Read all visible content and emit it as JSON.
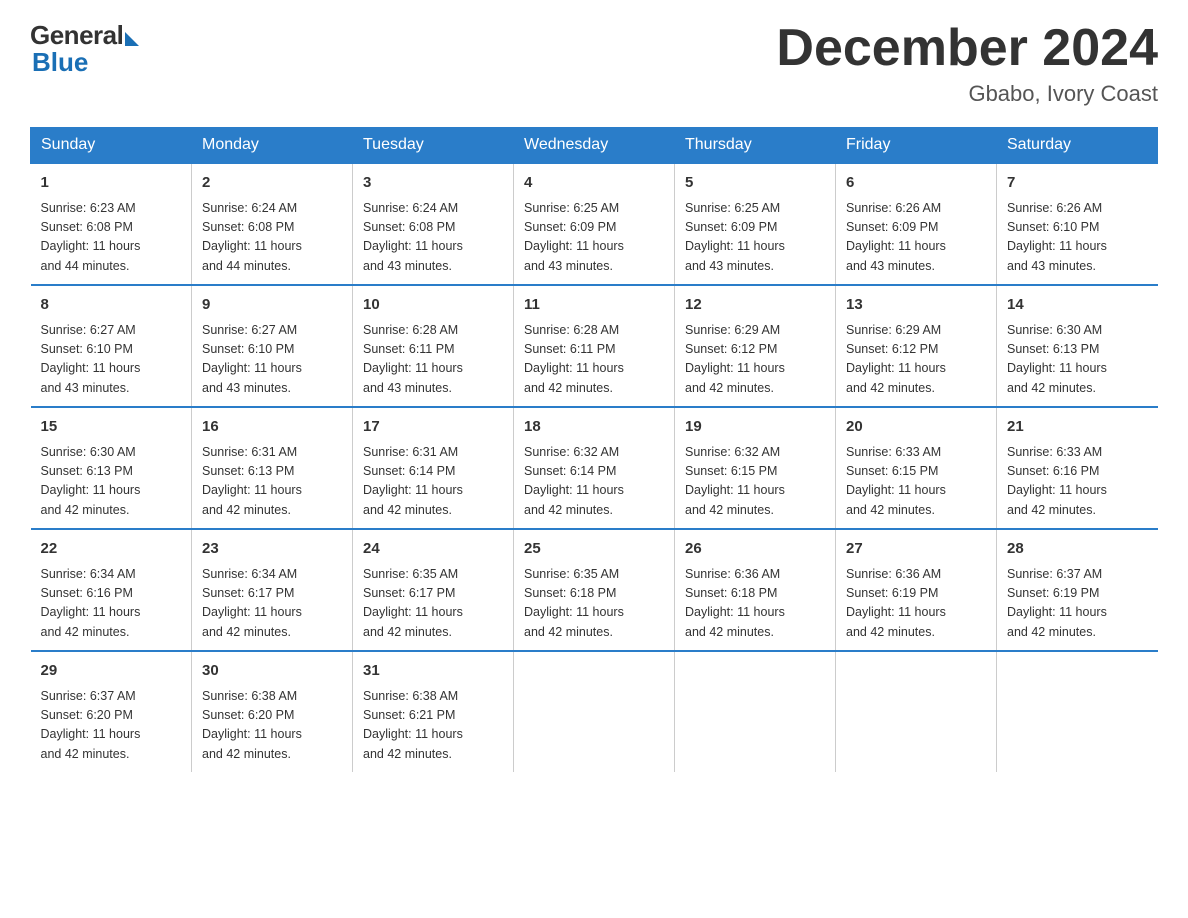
{
  "logo": {
    "general": "General",
    "blue": "Blue"
  },
  "title": "December 2024",
  "location": "Gbabo, Ivory Coast",
  "weekdays": [
    "Sunday",
    "Monday",
    "Tuesday",
    "Wednesday",
    "Thursday",
    "Friday",
    "Saturday"
  ],
  "weeks": [
    [
      {
        "day": "1",
        "sunrise": "6:23 AM",
        "sunset": "6:08 PM",
        "daylight": "11 hours and 44 minutes."
      },
      {
        "day": "2",
        "sunrise": "6:24 AM",
        "sunset": "6:08 PM",
        "daylight": "11 hours and 44 minutes."
      },
      {
        "day": "3",
        "sunrise": "6:24 AM",
        "sunset": "6:08 PM",
        "daylight": "11 hours and 43 minutes."
      },
      {
        "day": "4",
        "sunrise": "6:25 AM",
        "sunset": "6:09 PM",
        "daylight": "11 hours and 43 minutes."
      },
      {
        "day": "5",
        "sunrise": "6:25 AM",
        "sunset": "6:09 PM",
        "daylight": "11 hours and 43 minutes."
      },
      {
        "day": "6",
        "sunrise": "6:26 AM",
        "sunset": "6:09 PM",
        "daylight": "11 hours and 43 minutes."
      },
      {
        "day": "7",
        "sunrise": "6:26 AM",
        "sunset": "6:10 PM",
        "daylight": "11 hours and 43 minutes."
      }
    ],
    [
      {
        "day": "8",
        "sunrise": "6:27 AM",
        "sunset": "6:10 PM",
        "daylight": "11 hours and 43 minutes."
      },
      {
        "day": "9",
        "sunrise": "6:27 AM",
        "sunset": "6:10 PM",
        "daylight": "11 hours and 43 minutes."
      },
      {
        "day": "10",
        "sunrise": "6:28 AM",
        "sunset": "6:11 PM",
        "daylight": "11 hours and 43 minutes."
      },
      {
        "day": "11",
        "sunrise": "6:28 AM",
        "sunset": "6:11 PM",
        "daylight": "11 hours and 42 minutes."
      },
      {
        "day": "12",
        "sunrise": "6:29 AM",
        "sunset": "6:12 PM",
        "daylight": "11 hours and 42 minutes."
      },
      {
        "day": "13",
        "sunrise": "6:29 AM",
        "sunset": "6:12 PM",
        "daylight": "11 hours and 42 minutes."
      },
      {
        "day": "14",
        "sunrise": "6:30 AM",
        "sunset": "6:13 PM",
        "daylight": "11 hours and 42 minutes."
      }
    ],
    [
      {
        "day": "15",
        "sunrise": "6:30 AM",
        "sunset": "6:13 PM",
        "daylight": "11 hours and 42 minutes."
      },
      {
        "day": "16",
        "sunrise": "6:31 AM",
        "sunset": "6:13 PM",
        "daylight": "11 hours and 42 minutes."
      },
      {
        "day": "17",
        "sunrise": "6:31 AM",
        "sunset": "6:14 PM",
        "daylight": "11 hours and 42 minutes."
      },
      {
        "day": "18",
        "sunrise": "6:32 AM",
        "sunset": "6:14 PM",
        "daylight": "11 hours and 42 minutes."
      },
      {
        "day": "19",
        "sunrise": "6:32 AM",
        "sunset": "6:15 PM",
        "daylight": "11 hours and 42 minutes."
      },
      {
        "day": "20",
        "sunrise": "6:33 AM",
        "sunset": "6:15 PM",
        "daylight": "11 hours and 42 minutes."
      },
      {
        "day": "21",
        "sunrise": "6:33 AM",
        "sunset": "6:16 PM",
        "daylight": "11 hours and 42 minutes."
      }
    ],
    [
      {
        "day": "22",
        "sunrise": "6:34 AM",
        "sunset": "6:16 PM",
        "daylight": "11 hours and 42 minutes."
      },
      {
        "day": "23",
        "sunrise": "6:34 AM",
        "sunset": "6:17 PM",
        "daylight": "11 hours and 42 minutes."
      },
      {
        "day": "24",
        "sunrise": "6:35 AM",
        "sunset": "6:17 PM",
        "daylight": "11 hours and 42 minutes."
      },
      {
        "day": "25",
        "sunrise": "6:35 AM",
        "sunset": "6:18 PM",
        "daylight": "11 hours and 42 minutes."
      },
      {
        "day": "26",
        "sunrise": "6:36 AM",
        "sunset": "6:18 PM",
        "daylight": "11 hours and 42 minutes."
      },
      {
        "day": "27",
        "sunrise": "6:36 AM",
        "sunset": "6:19 PM",
        "daylight": "11 hours and 42 minutes."
      },
      {
        "day": "28",
        "sunrise": "6:37 AM",
        "sunset": "6:19 PM",
        "daylight": "11 hours and 42 minutes."
      }
    ],
    [
      {
        "day": "29",
        "sunrise": "6:37 AM",
        "sunset": "6:20 PM",
        "daylight": "11 hours and 42 minutes."
      },
      {
        "day": "30",
        "sunrise": "6:38 AM",
        "sunset": "6:20 PM",
        "daylight": "11 hours and 42 minutes."
      },
      {
        "day": "31",
        "sunrise": "6:38 AM",
        "sunset": "6:21 PM",
        "daylight": "11 hours and 42 minutes."
      },
      null,
      null,
      null,
      null
    ]
  ],
  "labels": {
    "sunrise": "Sunrise:",
    "sunset": "Sunset:",
    "daylight": "Daylight:"
  }
}
